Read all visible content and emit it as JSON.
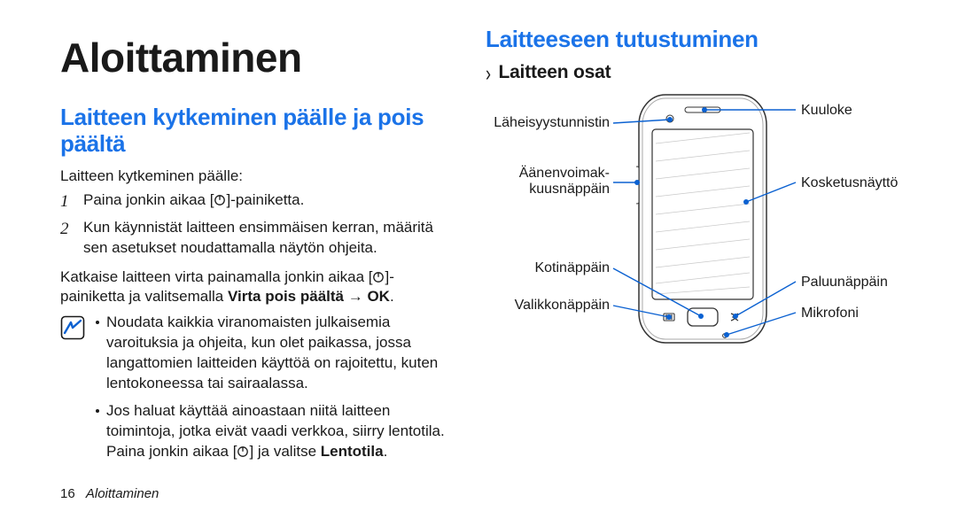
{
  "title": "Aloittaminen",
  "col1": {
    "h2": "Laitteen kytkeminen päälle ja pois päältä",
    "intro": "Laitteen kytkeminen päälle:",
    "steps": [
      {
        "n": "1",
        "pre": "Paina jonkin aikaa [",
        "post": "]-painiketta."
      },
      {
        "n": "2",
        "pre": "Kun käynnistät laitteen ensimmäisen kerran, määritä sen asetukset noudattamalla näytön ohjeita.",
        "post": ""
      }
    ],
    "off1": "Katkaise laitteen virta painamalla jonkin aikaa [",
    "off2": "]-painiketta ja valitsemalla ",
    "off3": "Virta pois päältä → OK",
    "off4": ".",
    "notes": [
      "Noudata kaikkia viranomaisten julkaisemia varoituksia ja ohjeita, kun olet paikassa, jossa langattomien laitteiden käyttöä on rajoitettu, kuten lentokoneessa tai sairaalassa.",
      "Jos haluat käyttää ainoastaan niitä laitteen toimintoja, jotka eivät vaadi verkkoa, siirry lentotila."
    ],
    "note2_tail_pre": "Paina jonkin aikaa [",
    "note2_tail_post_a": "] ja valitse ",
    "note2_tail_bold": "Lentotila",
    "note2_tail_post_b": "."
  },
  "col2": {
    "h2": "Laitteeseen tutustuminen",
    "h3": "Laitteen osat",
    "labels": {
      "proximity": "Läheisyystunnistin",
      "volume_a": "Äänenvoimak-",
      "volume_b": "kuusnäppäin",
      "home": "Kotinäppäin",
      "menu": "Valikkonäppäin",
      "earpiece": "Kuuloke",
      "touch": "Kosketusnäyttö",
      "back": "Paluunäppäin",
      "mic": "Mikrofoni"
    }
  },
  "footer": {
    "page": "16",
    "section": "Aloittaminen"
  }
}
